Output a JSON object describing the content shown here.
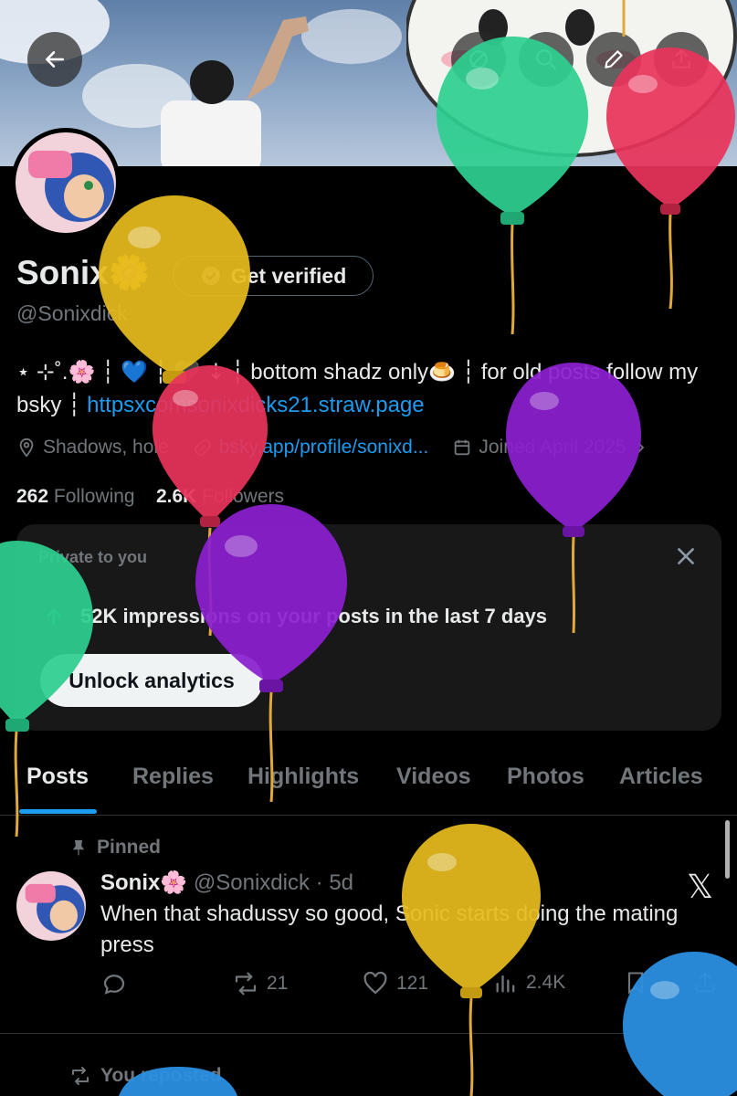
{
  "profile": {
    "name": "Sonix🌼",
    "get_verified": "Get verified",
    "handle": "@Sonixdick",
    "bio_part1": "⋆ ⊹˚.🌸 ┆ 💙 ┆ 🖤 ⇣ ┆ bottom shadz only🍮 ┆ for old posts follow my bsky ┆ ",
    "bio_link": "httpsxcomsonixdicks21.straw.page",
    "location": "Shadows, hole",
    "website": "bsky.app/profile/sonixd...",
    "joined": "Joined April 2025",
    "following_count": "262",
    "following_label": "Following",
    "followers_count": "2.6K",
    "followers_label": "Followers"
  },
  "analytics_card": {
    "label": "Private to you",
    "stat": "52K impressions on your posts in the last 7 days",
    "button": "Unlock analytics"
  },
  "tabs": [
    "Posts",
    "Replies",
    "Highlights",
    "Videos",
    "Photos",
    "Articles"
  ],
  "active_tab": "Posts",
  "pinned_post": {
    "pinned_label": "Pinned",
    "author": "Sonix🌸",
    "handle_time": "@Sonixdick · 5d",
    "text": "When that shadussy so good, Sonic starts doing the mating press",
    "reposts": "21",
    "likes": "121",
    "views": "2.4K"
  },
  "reposted_label": "You reposted",
  "icons": {
    "back": "back-arrow-icon",
    "search": "search-icon",
    "edit": "edit-pencil-icon",
    "share": "share-icon",
    "location": "location-pin-icon",
    "link": "link-icon",
    "calendar": "calendar-icon",
    "close": "close-icon",
    "arrow_up": "arrow-up-icon",
    "pin": "pin-icon",
    "reply": "reply-icon",
    "repost": "repost-icon",
    "like": "heart-icon",
    "views": "views-icon",
    "x_logo": "x-logo-icon"
  },
  "colors": {
    "accent": "#1d9bf0",
    "balloon_green": "#2ecf8f",
    "balloon_red": "#e8345a",
    "balloon_yellow": "#e6bb1e",
    "balloon_purple": "#8b1fd0",
    "balloon_blue": "#2b8fe0"
  }
}
